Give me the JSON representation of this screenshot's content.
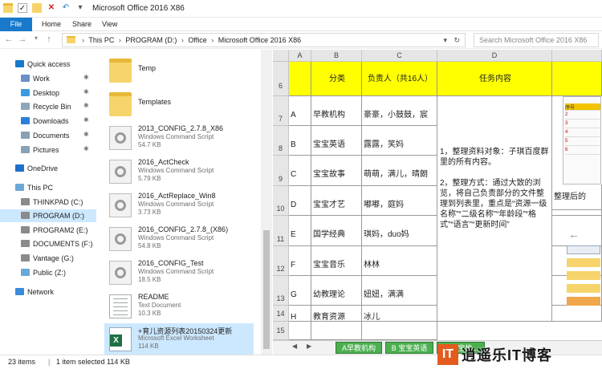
{
  "window": {
    "title": "Microsoft Office 2016 X86"
  },
  "ribbon": {
    "file": "File",
    "tabs": [
      "Home",
      "Share",
      "View"
    ]
  },
  "address": {
    "path": [
      "This PC",
      "PROGRAM (D:)",
      "Office",
      "Microsoft Office 2016 X86"
    ],
    "search_placeholder": "Search Microsoft Office 2016 X86"
  },
  "nav": {
    "items": [
      {
        "label": "Quick access",
        "icon": "star-icon",
        "color": "#1979ca",
        "pinned": false
      },
      {
        "label": "Work",
        "icon": "folder-icon",
        "color": "#6b8fc8",
        "pinned": true
      },
      {
        "label": "Desktop",
        "icon": "desktop-icon",
        "color": "#3a9be0",
        "pinned": true
      },
      {
        "label": "Recycle Bin",
        "icon": "recycle-bin-icon",
        "color": "#8fa6b8",
        "pinned": true
      },
      {
        "label": "Downloads",
        "icon": "download-icon",
        "color": "#2b7fd6",
        "pinned": true
      },
      {
        "label": "Documents",
        "icon": "documents-icon",
        "color": "#8aa0b4",
        "pinned": true
      },
      {
        "label": "Pictures",
        "icon": "pictures-icon",
        "color": "#8aa0b4",
        "pinned": true
      },
      {
        "label": "OneDrive",
        "icon": "cloud-icon",
        "color": "#1e6fc8",
        "pinned": false
      },
      {
        "label": "This PC",
        "icon": "computer-icon",
        "color": "#6aa8d8",
        "pinned": false
      },
      {
        "label": "THINKPAD (C:)",
        "icon": "drive-icon",
        "color": "#8b8b8b",
        "pinned": false
      },
      {
        "label": "PROGRAM (D:)",
        "icon": "drive-icon",
        "color": "#8b8b8b",
        "pinned": false
      },
      {
        "label": "PROGRAM2 (E:)",
        "icon": "drive-icon",
        "color": "#8b8b8b",
        "pinned": false
      },
      {
        "label": "DOCUMENTS (F:)",
        "icon": "drive-icon",
        "color": "#8b8b8b",
        "pinned": false
      },
      {
        "label": "Vantage (G:)",
        "icon": "drive-icon",
        "color": "#8b8b8b",
        "pinned": false
      },
      {
        "label": "Public (Z:)",
        "icon": "network-drive-icon",
        "color": "#6aa8d8",
        "pinned": false
      },
      {
        "label": "Network",
        "icon": "network-icon",
        "color": "#3a8bd8",
        "pinned": false
      }
    ],
    "selected": "PROGRAM (D:)"
  },
  "files": [
    {
      "name": "Temp",
      "type": "",
      "size": "",
      "kind": "folder"
    },
    {
      "name": "Templates",
      "type": "",
      "size": "",
      "kind": "folder"
    },
    {
      "name": "2013_CONFIG_2.7.8_X86",
      "type": "Windows Command Script",
      "size": "54.7 KB",
      "kind": "script"
    },
    {
      "name": "2016_ActCheck",
      "type": "Windows Command Script",
      "size": "5.79 KB",
      "kind": "script"
    },
    {
      "name": "2016_ActReplace_Win8",
      "type": "Windows Command Script",
      "size": "3.73 KB",
      "kind": "script"
    },
    {
      "name": "2016_CONFIG_2.7.8_(X86)",
      "type": "Windows Command Script",
      "size": "54.8 KB",
      "kind": "script"
    },
    {
      "name": "2016_CONFIG_Test",
      "type": "Windows Command Script",
      "size": "18.5 KB",
      "kind": "script"
    },
    {
      "name": "README",
      "type": "Text Document",
      "size": "10.3 KB",
      "kind": "text"
    },
    {
      "name": "+育儿资源列表20150324更新",
      "type": "Microsoft Excel Worksheet",
      "size": "114 KB",
      "kind": "excel"
    }
  ],
  "sheet": {
    "columns": [
      "A",
      "B",
      "C",
      "D"
    ],
    "row_numbers": [
      "6",
      "7",
      "8",
      "9",
      "10",
      "11",
      "12",
      "13",
      "14",
      "15"
    ],
    "headers": {
      "b": "分类",
      "c": "负责人（共16人）",
      "d": "任务内容"
    },
    "rows": [
      {
        "a": "A",
        "b": "早教机构",
        "c": "豪豪，小鼓鼓，宸"
      },
      {
        "a": "B",
        "b": "宝宝英语",
        "c": "露露，笑妈"
      },
      {
        "a": "C",
        "b": "宝宝故事",
        "c": "萌萌，满儿，晴朗"
      },
      {
        "a": "D",
        "b": "宝宝才艺",
        "c": "嘟嘟，庭妈"
      },
      {
        "a": "E",
        "b": "国学经典",
        "c": "琪妈，duo妈"
      },
      {
        "a": "F",
        "b": "宝宝音乐",
        "c": "林林"
      },
      {
        "a": "G",
        "b": "幼教理论",
        "c": "妞妞，满满"
      },
      {
        "a": "H",
        "b": "教育资源",
        "c": "冰儿"
      }
    ],
    "task": {
      "p1": "1，整理资料对象：子琪百度群里的所有内容。",
      "p2": "2，整理方式：通过大致的浏览，将自己负责部分的文件整理到列表里，重点是“资源一级名称”“二级名称”“年龄段”“格式”“语言”“更新时间”"
    },
    "right_text": "整理后的",
    "mini_rows": [
      "序号",
      "2",
      "3",
      "4",
      "5",
      "6"
    ],
    "sheet_tabs": [
      "A早教机构",
      "B 宝宝英语",
      "C 宝宝故..."
    ]
  },
  "status": {
    "items": "23 items",
    "selected": "1 item selected  114 KB"
  },
  "watermark": {
    "badge": "IT",
    "text": "逍遥乐IT博客"
  },
  "colors": {
    "accent": "#1979ca",
    "selection": "#cce8ff",
    "yellow": "#ffff00",
    "sheet_tab": "#4caf50"
  }
}
